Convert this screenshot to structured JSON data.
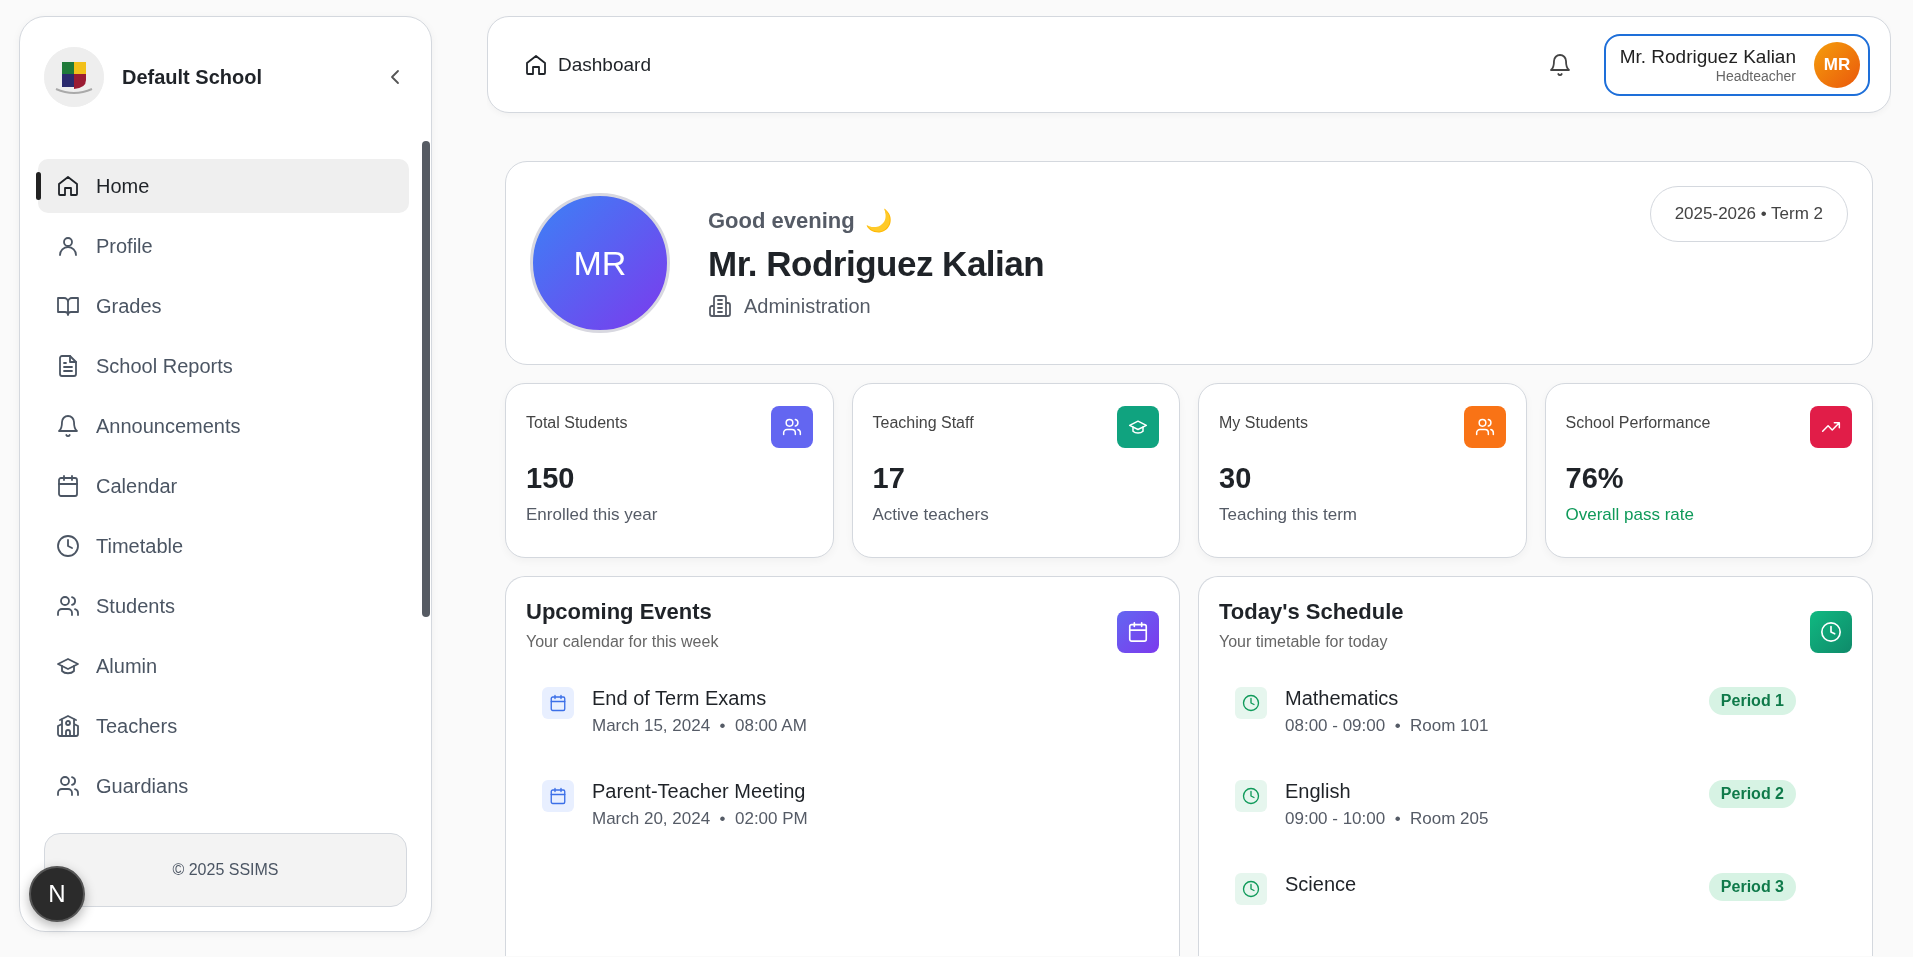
{
  "sidebar": {
    "school_name": "Default School",
    "items": [
      {
        "label": "Home",
        "selected": true
      },
      {
        "label": "Profile",
        "selected": false
      },
      {
        "label": "Grades",
        "selected": false
      },
      {
        "label": "School Reports",
        "selected": false
      },
      {
        "label": "Announcements",
        "selected": false
      },
      {
        "label": "Calendar",
        "selected": false
      },
      {
        "label": "Timetable",
        "selected": false
      },
      {
        "label": "Students",
        "selected": false
      },
      {
        "label": "Alumin",
        "selected": false
      },
      {
        "label": "Teachers",
        "selected": false
      },
      {
        "label": "Guardians",
        "selected": false
      }
    ],
    "footer": "© 2025 SSIMS"
  },
  "dev_badge": "N",
  "header": {
    "breadcrumb": "Dashboard",
    "user": {
      "name": "Mr. Rodriguez Kalian",
      "role": "Headteacher",
      "initials": "MR"
    }
  },
  "welcome": {
    "initials": "MR",
    "greeting": "Good evening",
    "emoji": "🌙",
    "name": "Mr. Rodriguez Kalian",
    "department": "Administration",
    "term": "2025-2026 • Term 2"
  },
  "stats": [
    {
      "title": "Total Students",
      "value": "150",
      "note": "Enrolled this year",
      "color": "#6366f1",
      "positive": false
    },
    {
      "title": "Teaching Staff",
      "value": "17",
      "note": "Active teachers",
      "color": "#10a37f",
      "positive": false
    },
    {
      "title": "My Students",
      "value": "30",
      "note": "Teaching this term",
      "color": "#f97316",
      "positive": false
    },
    {
      "title": "School Performance",
      "value": "76%",
      "note": "Overall pass rate",
      "color": "#e11d48",
      "positive": true
    }
  ],
  "events": {
    "title": "Upcoming Events",
    "subtitle": "Your calendar for this week",
    "items": [
      {
        "title": "End of Term Exams",
        "date": "March 15, 2024",
        "separator": "•",
        "time": "08:00 AM"
      },
      {
        "title": "Parent-Teacher Meeting",
        "date": "March 20, 2024",
        "separator": "•",
        "time": "02:00 PM"
      }
    ]
  },
  "schedule": {
    "title": "Today's Schedule",
    "subtitle": "Your timetable for today",
    "items": [
      {
        "subject": "Mathematics",
        "time": "08:00 - 09:00",
        "separator": "•",
        "room": "Room 101",
        "period": "Period 1"
      },
      {
        "subject": "English",
        "time": "09:00 - 10:00",
        "separator": "•",
        "room": "Room 205",
        "period": "Period 2"
      },
      {
        "subject": "Science",
        "period": "Period 3"
      }
    ]
  }
}
